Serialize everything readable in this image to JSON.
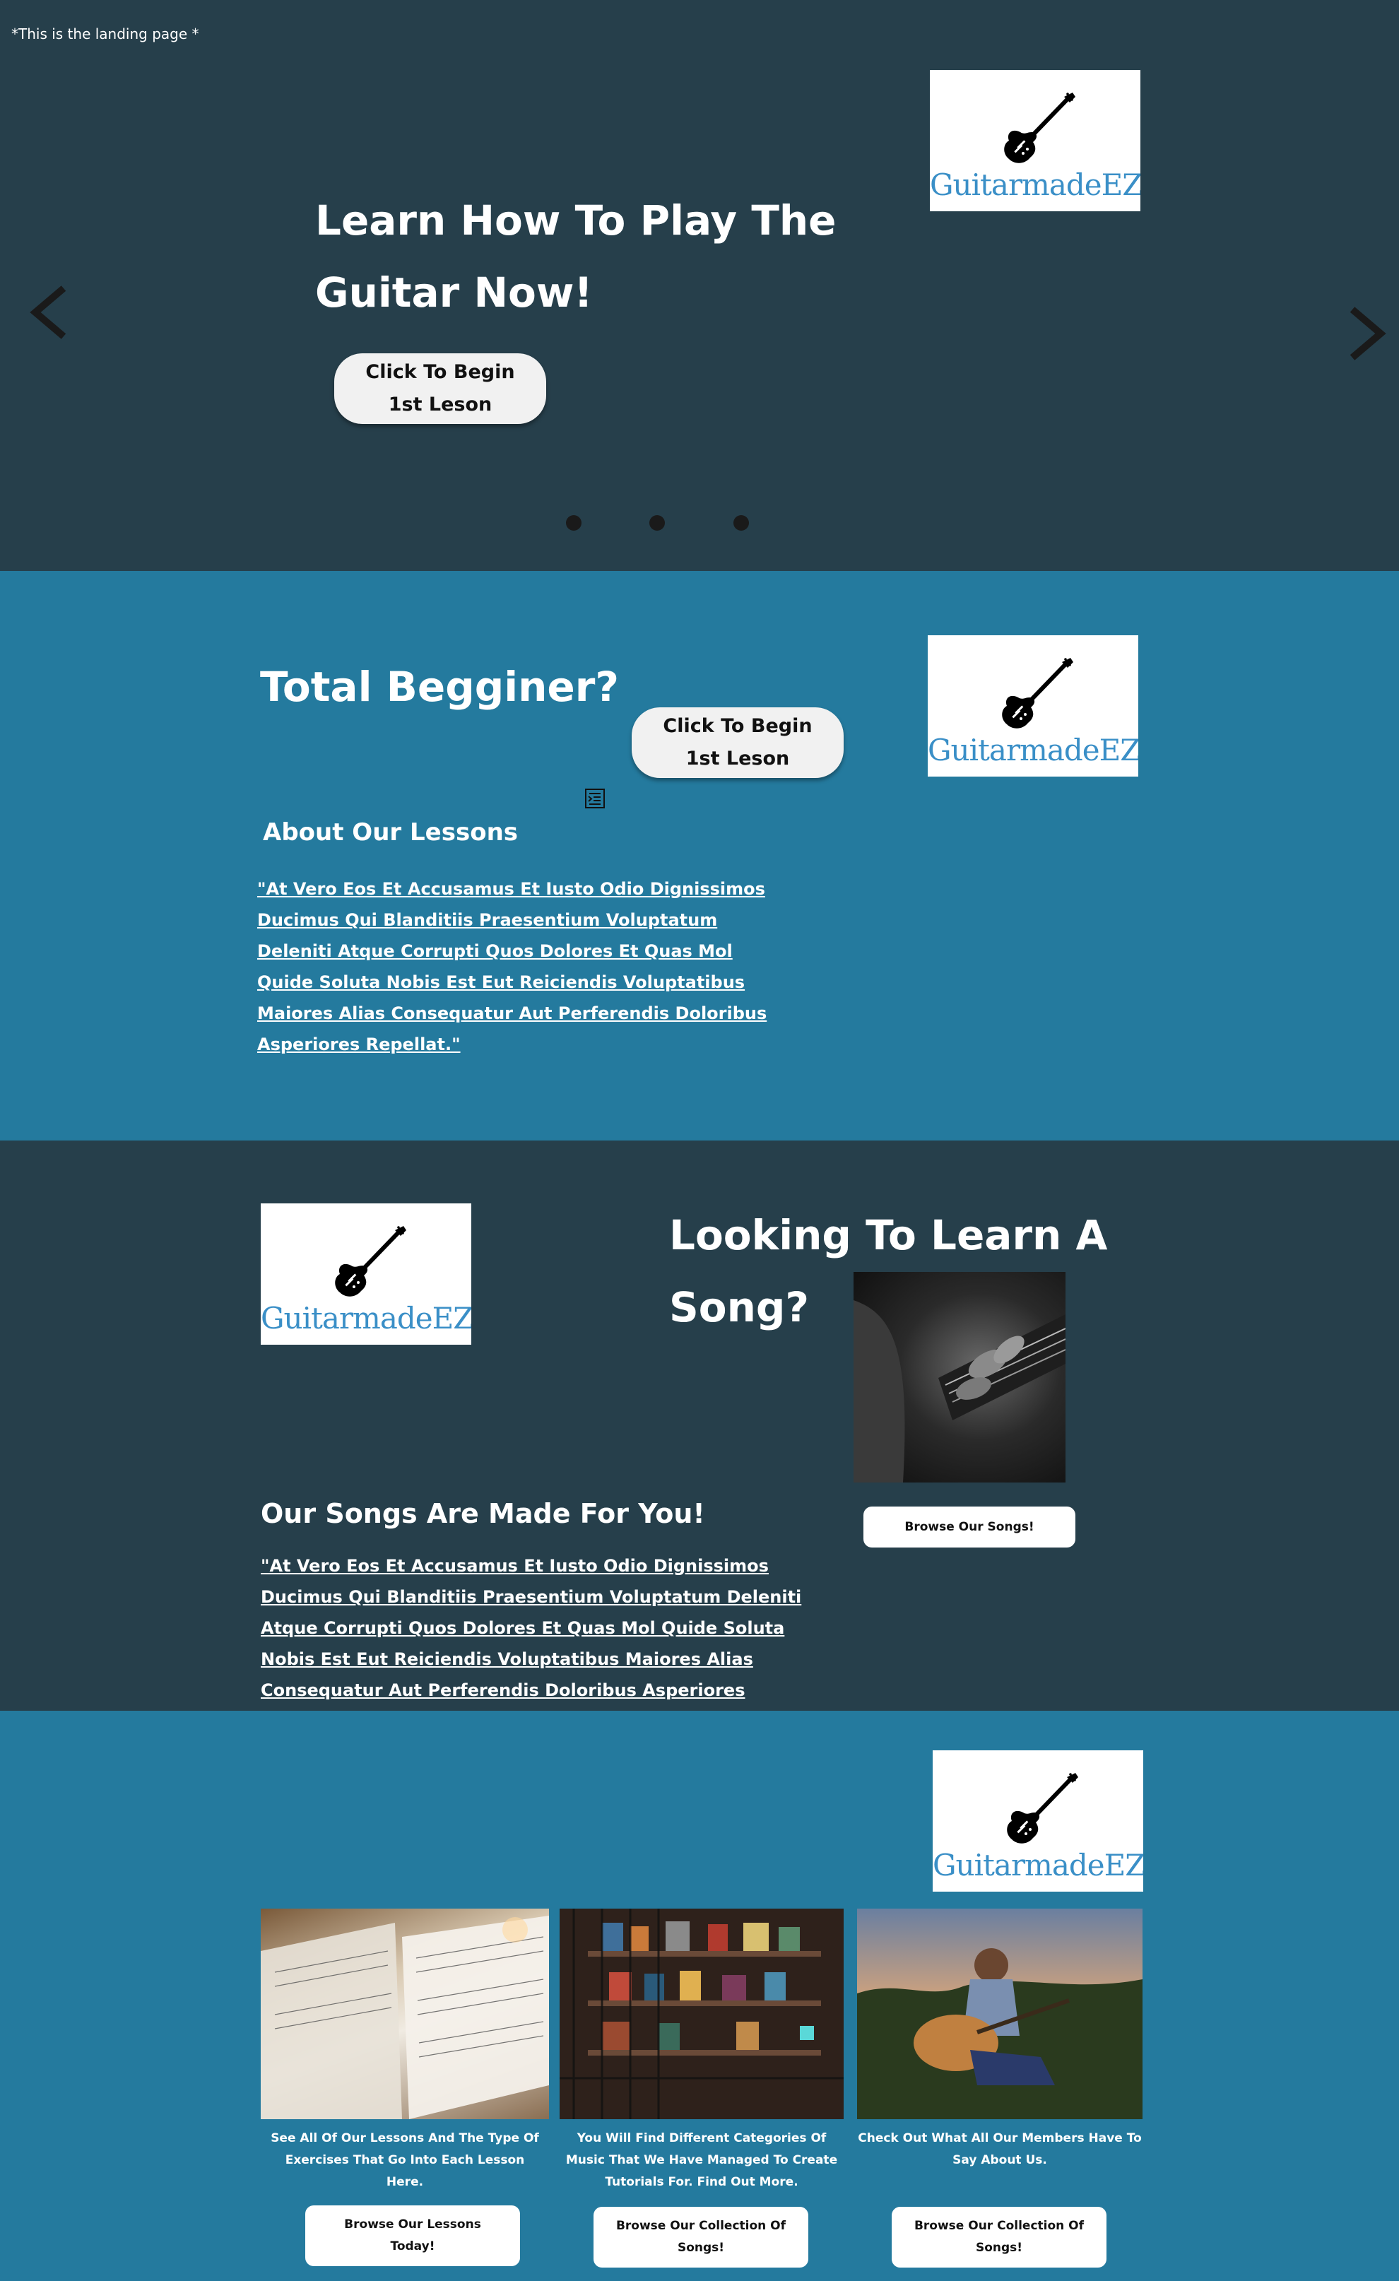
{
  "note": "*This is the landing page *",
  "brand": {
    "name": "GuitarmadeEZ",
    "accent": "#3a8fc7"
  },
  "colors": {
    "dark": "#263f4b",
    "blue": "#247a9e"
  },
  "hero": {
    "title_line1": "Learn How To Play The",
    "title_line2": "Guitar Now!",
    "cta": "Click To Begin 1st Leson",
    "prev_icon": "chevron-left-icon",
    "next_icon": "chevron-right-icon",
    "slides": 3,
    "active_slide": 1
  },
  "beginner": {
    "title": "Total Begginer?",
    "cta": "Click To Begin 1st Leson",
    "about_title": "About Our Lessons",
    "quote": "\"At Vero Eos Et Accusamus Et Iusto Odio Dignissimos Ducimus Qui Blanditiis Praesentium Voluptatum Deleniti Atque Corrupti Quos Dolores Et Quas Mol Quide Soluta Nobis Est Eut Reiciendis Voluptatibus Maiores Alias Consequatur Aut Perferendis Doloribus Asperiores Repellat.\""
  },
  "songs": {
    "title_line1": "Looking To Learn A",
    "title_line2": "Song?",
    "subtitle": "Our Songs Are Made For You!",
    "quote": "\"At Vero Eos Et Accusamus Et Iusto Odio Dignissimos Ducimus Qui Blanditiis Praesentium Voluptatum Deleniti Atque Corrupti Quos Dolores Et Quas Mol Quide Soluta Nobis Est Eut Reiciendis Voluptatibus Maiores Alias Consequatur Aut Perferendis Doloribus Asperiores Repellat.\"",
    "cta": "Browse Our Songs!"
  },
  "cards": [
    {
      "caption": "See All Of Our Lessons And The Type Of Exercises That Go Into Each Lesson Here.",
      "button": "Browse Our Lessons Today!"
    },
    {
      "caption": "You Will Find Different Categories Of Music That We Have Managed To Create Tutorials For. Find Out More.",
      "button": "Browse Our Collection Of Songs!"
    },
    {
      "caption": "Check Out What All Our Members Have To Say About Us.",
      "button": "Browse Our Collection Of Songs!"
    }
  ]
}
